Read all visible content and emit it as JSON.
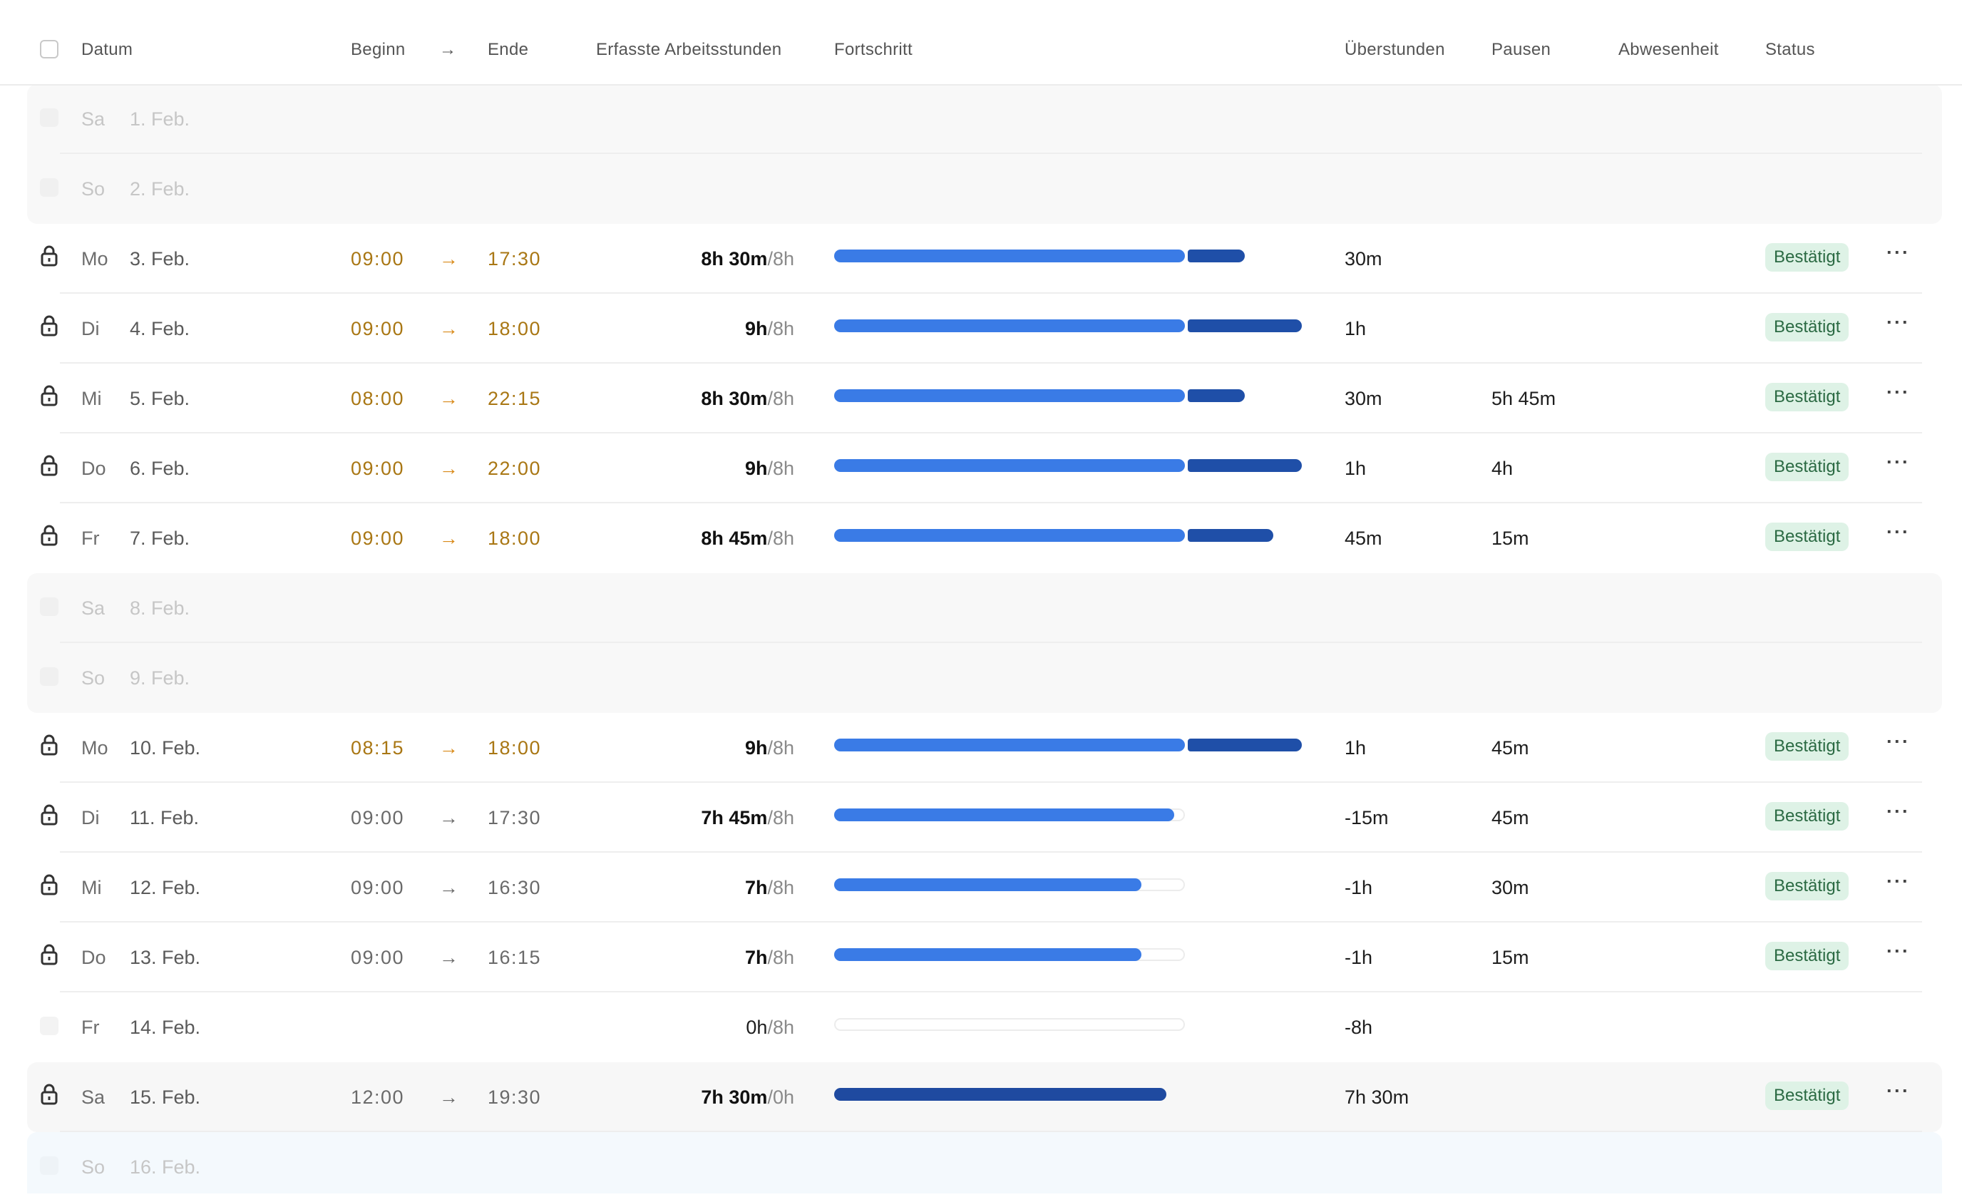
{
  "header": {
    "date": "Datum",
    "begin": "Beginn",
    "arrow": "→",
    "end": "Ende",
    "hours": "Erfasste Arbeitsstunden",
    "progress": "Fortschritt",
    "overtime": "Überstunden",
    "breaks": "Pausen",
    "absence": "Abwesenheit",
    "status": "Status"
  },
  "colors": {
    "bar_normal": "#3a7be6",
    "bar_overtime": "#1f4fa8",
    "status_badge_bg": "#def2e6",
    "status_badge_text": "#2b6a43",
    "time_accent": "#a97714",
    "arrow_accent": "#d88918"
  },
  "rows": [
    {
      "day": "Sa",
      "date": "1. Feb."
    },
    {
      "day": "So",
      "date": "2. Feb."
    },
    {
      "day": "Mo",
      "date": "3. Feb.",
      "begin": "09:00",
      "arrow": "→",
      "end": "17:30",
      "hours": "8h 30m",
      "target": "/8h",
      "progress": 1.0625,
      "overtime": "30m",
      "breaks": "",
      "status": "Bestätigt",
      "more": "···"
    },
    {
      "day": "Di",
      "date": "4. Feb.",
      "begin": "09:00",
      "arrow": "→",
      "end": "18:00",
      "hours": "9h",
      "target": "/8h",
      "progress": 1.125,
      "overtime": "1h",
      "breaks": "",
      "status": "Bestätigt",
      "more": "···"
    },
    {
      "day": "Mi",
      "date": "5. Feb.",
      "begin": "08:00",
      "arrow": "→",
      "end": "22:15",
      "hours": "8h 30m",
      "target": "/8h",
      "progress": 1.0625,
      "overtime": "30m",
      "breaks": "5h 45m",
      "status": "Bestätigt",
      "more": "···"
    },
    {
      "day": "Do",
      "date": "6. Feb.",
      "begin": "09:00",
      "arrow": "→",
      "end": "22:00",
      "hours": "9h",
      "target": "/8h",
      "progress": 1.125,
      "overtime": "1h",
      "breaks": "4h",
      "status": "Bestätigt",
      "more": "···"
    },
    {
      "day": "Fr",
      "date": "7. Feb.",
      "begin": "09:00",
      "arrow": "→",
      "end": "18:00",
      "hours": "8h 45m",
      "target": "/8h",
      "progress": 1.09375,
      "overtime": "45m",
      "breaks": "15m",
      "status": "Bestätigt",
      "more": "···"
    },
    {
      "day": "Sa",
      "date": "8. Feb."
    },
    {
      "day": "So",
      "date": "9. Feb."
    },
    {
      "day": "Mo",
      "date": "10. Feb.",
      "begin": "08:15",
      "arrow": "→",
      "end": "18:00",
      "hours": "9h",
      "target": "/8h",
      "progress": 1.125,
      "overtime": "1h",
      "breaks": "45m",
      "status": "Bestätigt",
      "more": "···"
    },
    {
      "day": "Di",
      "date": "11. Feb.",
      "begin": "09:00",
      "arrow": "→",
      "end": "17:30",
      "hours": "7h 45m",
      "target": "/8h",
      "progress": 0.96875,
      "overtime": "-15m",
      "breaks": "45m",
      "status": "Bestätigt",
      "more": "···"
    },
    {
      "day": "Mi",
      "date": "12. Feb.",
      "begin": "09:00",
      "arrow": "→",
      "end": "16:30",
      "hours": "7h",
      "target": "/8h",
      "progress": 0.875,
      "overtime": "-1h",
      "breaks": "30m",
      "status": "Bestätigt",
      "more": "···"
    },
    {
      "day": "Do",
      "date": "13. Feb.",
      "begin": "09:00",
      "arrow": "→",
      "end": "16:15",
      "hours": "7h",
      "target": "/8h",
      "progress": 0.875,
      "overtime": "-1h",
      "breaks": "15m",
      "status": "Bestätigt",
      "more": "···"
    },
    {
      "day": "Fr",
      "date": "14. Feb.",
      "hours": "0h",
      "target": "/8h",
      "progress": 0,
      "overtime": "-8h"
    },
    {
      "day": "Sa",
      "date": "15. Feb.",
      "begin": "12:00",
      "arrow": "→",
      "end": "19:30",
      "hours": "7h 30m",
      "target": "/0h",
      "overtime": "7h 30m",
      "status": "Bestätigt",
      "more": "···"
    },
    {
      "day": "So",
      "date": "16. Feb."
    }
  ]
}
